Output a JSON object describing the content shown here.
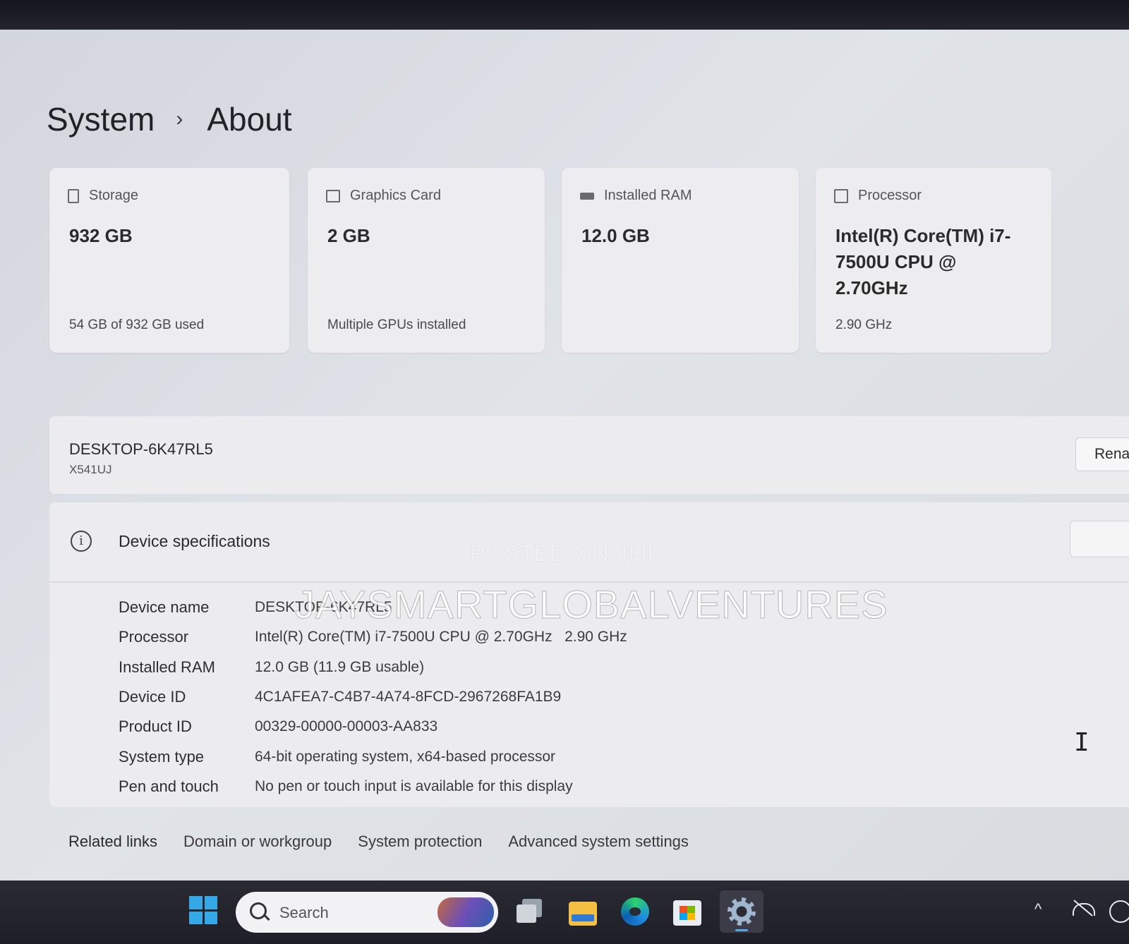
{
  "breadcrumb": {
    "parent": "System",
    "separator": "›",
    "current": "About"
  },
  "cards": [
    {
      "icon": "storage-icon",
      "label": "Storage",
      "value": "932 GB",
      "sub": "54 GB of 932 GB used"
    },
    {
      "icon": "graphics-card-icon",
      "label": "Graphics Card",
      "value": "2 GB",
      "sub": "Multiple GPUs installed"
    },
    {
      "icon": "ram-icon",
      "label": "Installed RAM",
      "value": "12.0 GB",
      "sub": ""
    },
    {
      "icon": "processor-icon",
      "label": "Processor",
      "value": "Intel(R) Core(TM) i7-7500U CPU @ 2.70GHz",
      "sub": "2.90 GHz"
    }
  ],
  "device": {
    "name": "DESKTOP-6K47RL5",
    "model": "X541UJ",
    "rename_label": "Rena"
  },
  "specs": {
    "title": "Device specifications",
    "rows": [
      {
        "key": "Device name",
        "value": "DESKTOP-6K47RL5"
      },
      {
        "key": "Processor",
        "value": "Intel(R) Core(TM) i7-7500U CPU @ 2.70GHz   2.90 GHz"
      },
      {
        "key": "Installed RAM",
        "value": "12.0 GB (11.9 GB usable)"
      },
      {
        "key": "Device ID",
        "value": "4C1AFEA7-C4B7-4A74-8FCD-2967268FA1B9"
      },
      {
        "key": "Product ID",
        "value": "00329-00000-00003-AA833"
      },
      {
        "key": "System type",
        "value": "64-bit operating system, x64-based processor"
      },
      {
        "key": "Pen and touch",
        "value": "No pen or touch input is available for this display"
      }
    ]
  },
  "related": {
    "label": "Related links",
    "links": [
      "Domain or workgroup",
      "System protection",
      "Advanced system settings"
    ]
  },
  "watermark": {
    "line1": "POSTED ON JIJI",
    "line2": "JAYSMARTGLOBALVENTURES"
  },
  "taskbar": {
    "search_placeholder": "Search",
    "icons": [
      "start-icon",
      "task-view-icon",
      "file-explorer-icon",
      "edge-icon",
      "store-icon",
      "settings-icon"
    ],
    "tray": {
      "chevron": "^"
    }
  },
  "colors": {
    "accent": "#35a8e8",
    "page_bg": "#dcdfe4",
    "card_bg": "#ededef",
    "taskbar_bg": "#24242d"
  }
}
